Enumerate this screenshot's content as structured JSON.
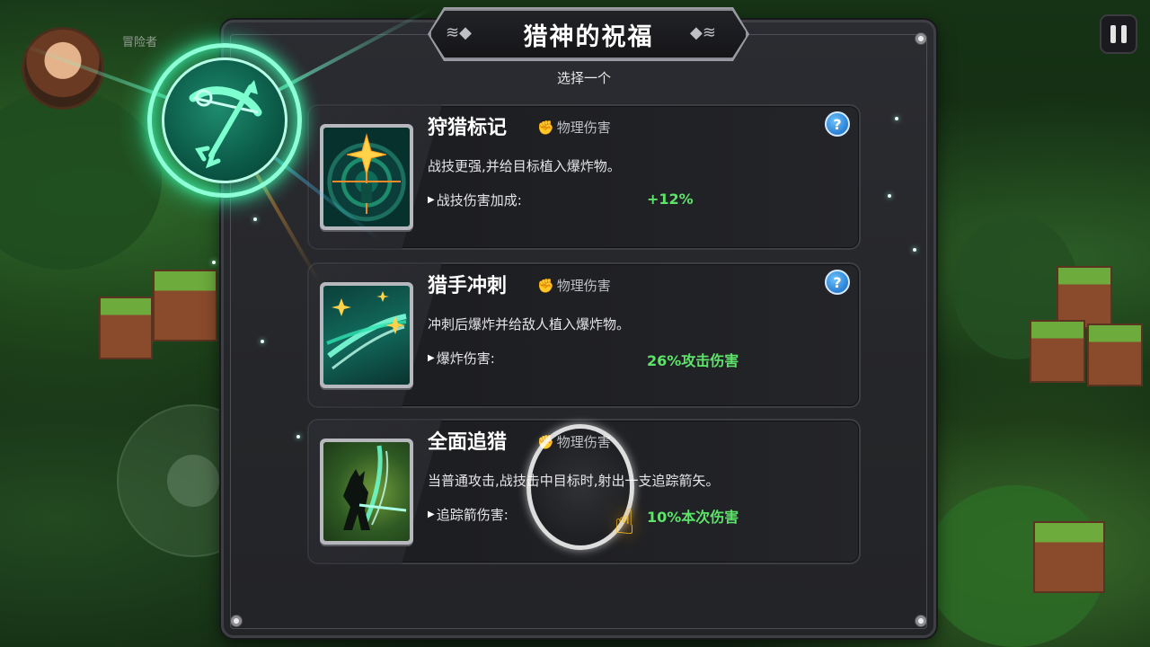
{
  "hud": {
    "player_name": "冒险者",
    "pause_icon": "pause-icon"
  },
  "dialog": {
    "title": "猎神的祝福",
    "subtitle": "选择一个",
    "emblem_icon": "bow-and-arrow-icon"
  },
  "cards": [
    {
      "name": "狩猎标记",
      "damage_type": "物理伤害",
      "icon": "target-star-icon",
      "has_help": true,
      "help_label": "?",
      "description": "战技更强,并给目标植入爆炸物。",
      "stat_label": "战技伤害加成:",
      "stat_value": "+12%"
    },
    {
      "name": "猎手冲刺",
      "damage_type": "物理伤害",
      "icon": "dash-burst-icon",
      "has_help": true,
      "help_label": "?",
      "description": "冲刺后爆炸并给敌人植入爆炸物。",
      "stat_label": "爆炸伤害:",
      "stat_value": "26%攻击伤害"
    },
    {
      "name": "全面追猎",
      "damage_type": "物理伤害",
      "icon": "hunter-silhouette-icon",
      "has_help": false,
      "description": "当普通攻击,战技击中目标时,射出一支追踪箭矢。",
      "stat_label": "追踪箭伤害:",
      "stat_value": "10%本次伤害"
    }
  ],
  "colors": {
    "stat_value": "#5ee36a",
    "emblem_glow": "#3dffb4",
    "panel_bg": "#2b2c31",
    "help_blue": "#2a7fd1",
    "tap_hand": "#ffc21a"
  }
}
